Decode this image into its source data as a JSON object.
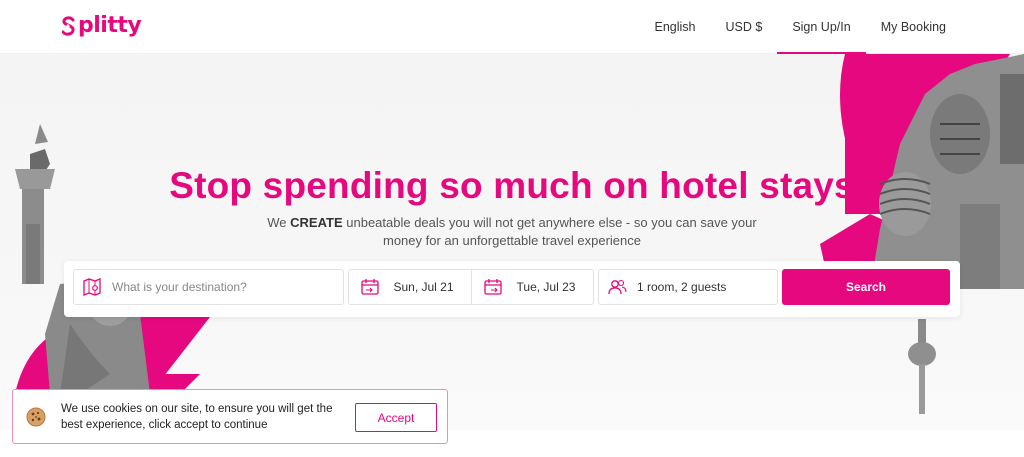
{
  "brand": {
    "name": "plitty",
    "logo_color": "#e5087e"
  },
  "nav": {
    "language": "English",
    "currency": "USD $",
    "signup": "Sign Up/In",
    "booking": "My Booking"
  },
  "hero": {
    "headline": "Stop spending so much on hotel stays",
    "subtitle_pre": "We ",
    "subtitle_strong": "CREATE",
    "subtitle_post": " unbeatable deals you will not get anywhere else - so you can save your money for an unforgettable travel experience"
  },
  "search": {
    "destination_placeholder": "What is your destination?",
    "checkin": "Sun, Jul 21",
    "checkout": "Tue, Jul 23",
    "guests": "1 room, 2 guests",
    "button": "Search"
  },
  "cookie": {
    "message": "We use cookies on our site, to ensure you will get the best experience, click accept to continue",
    "accept": "Accept"
  },
  "colors": {
    "accent": "#e5087e",
    "text": "#333333",
    "border": "#e2e2e2"
  },
  "icons": {
    "destination": "map-pin-icon",
    "checkin": "calendar-checkin-icon",
    "checkout": "calendar-checkout-icon",
    "guests": "users-icon",
    "cookie": "cookie-icon"
  }
}
